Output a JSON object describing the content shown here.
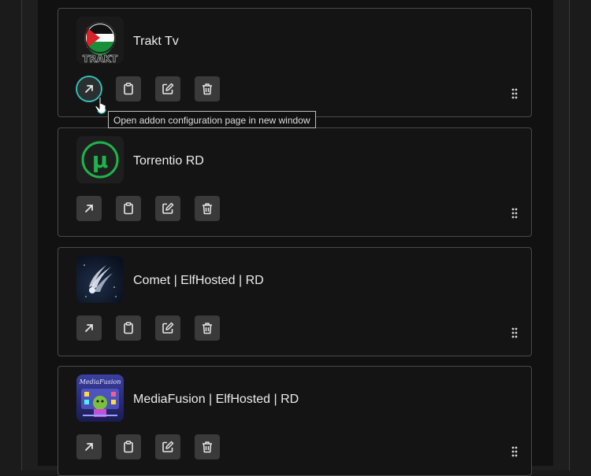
{
  "addons": [
    {
      "name": "Trakt Tv",
      "logo": "trakt-logo"
    },
    {
      "name": "Torrentio RD",
      "logo": "torrentio-logo"
    },
    {
      "name": "Comet | ElfHosted | RD",
      "logo": "comet-logo"
    },
    {
      "name": "MediaFusion | ElfHosted | RD",
      "logo": "mediafusion-logo"
    }
  ],
  "trakt_logo_text": "TRAKT",
  "torrentio_logo_glyph": "µ",
  "mediafusion_logo_text": "MediaFusion",
  "tooltip": "Open addon configuration page in new window",
  "actions": [
    "open-external-icon",
    "clipboard-icon",
    "edit-icon",
    "trash-icon"
  ],
  "colors": {
    "accent": "#3fd0c9",
    "torrentio_green": "#1fb34a",
    "button_bg": "#3a3a3a"
  }
}
